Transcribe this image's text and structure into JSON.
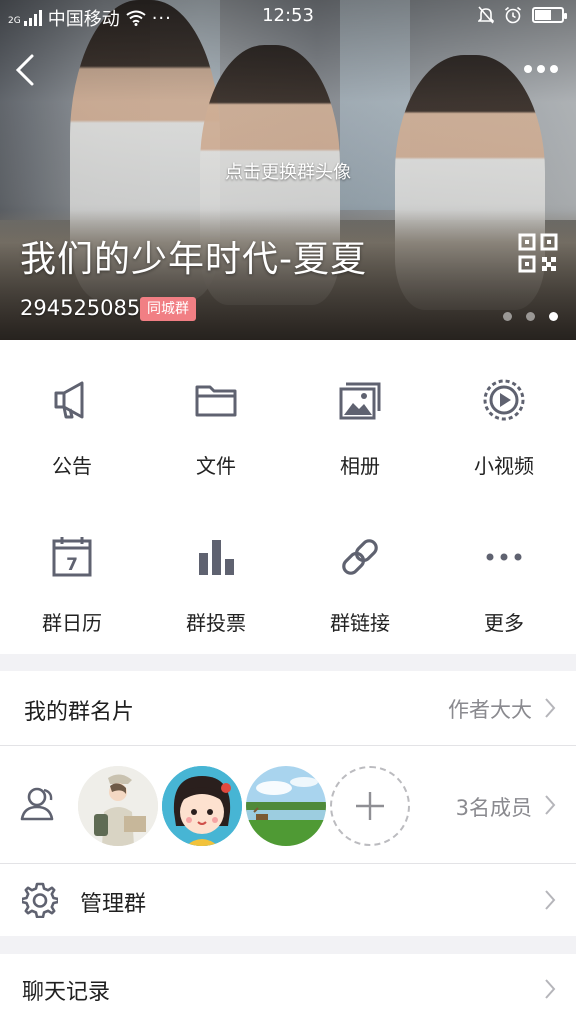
{
  "status_bar": {
    "network": "中国移动",
    "time": "12:53",
    "signal_label": "2G",
    "battery_level": 0.6
  },
  "header": {
    "avatar_hint": "点击更换群头像",
    "group_name": "我们的少年时代-夏夏",
    "group_id": "294525085",
    "group_tag": "同城群",
    "pager_count": 3,
    "pager_active": 2
  },
  "features": [
    {
      "label": "公告",
      "icon": "megaphone-icon"
    },
    {
      "label": "文件",
      "icon": "folder-icon"
    },
    {
      "label": "相册",
      "icon": "album-icon"
    },
    {
      "label": "小视频",
      "icon": "video-play-icon"
    },
    {
      "label": "群日历",
      "icon": "calendar-icon",
      "day": "7"
    },
    {
      "label": "群投票",
      "icon": "bar-chart-icon"
    },
    {
      "label": "群链接",
      "icon": "link-icon"
    },
    {
      "label": "更多",
      "icon": "more-dots-icon"
    }
  ],
  "card": {
    "title": "我的群名片",
    "value": "作者大大"
  },
  "members": {
    "count_label": "3名成员",
    "icon": "members-icon"
  },
  "manage": {
    "title": "管理群",
    "icon": "gear-icon"
  },
  "chat_history": {
    "title": "聊天记录"
  },
  "colors": {
    "icon_gray": "#5f6270",
    "tag_pink": "#f17f84",
    "chevron": "#b5b5ba"
  }
}
